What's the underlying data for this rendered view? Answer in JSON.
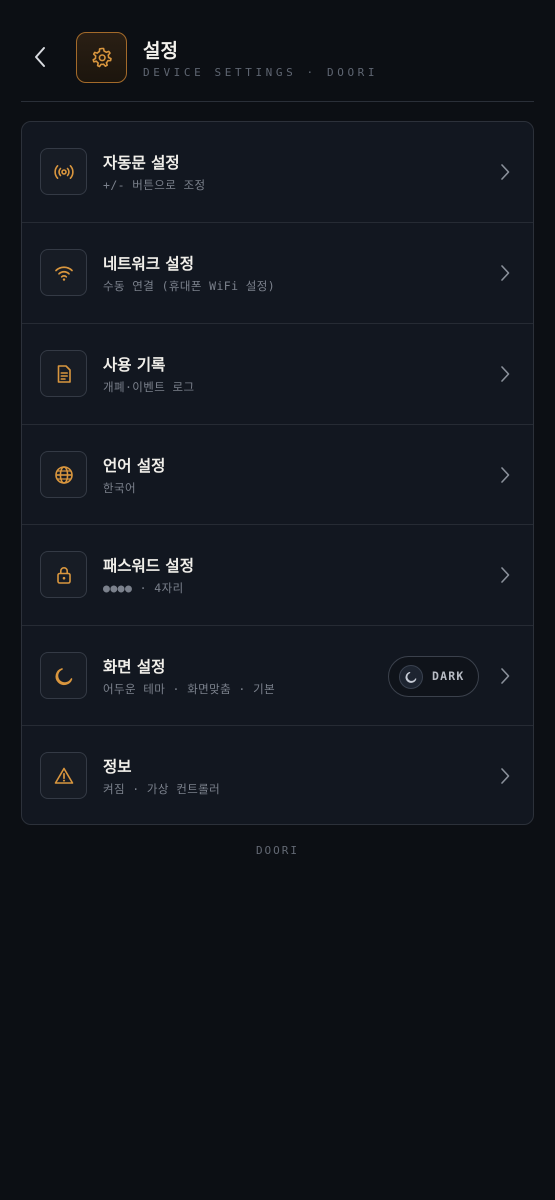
{
  "header": {
    "title": "설정",
    "subtitle": "DEVICE SETTINGS · DOORI",
    "back_icon": "chevron-left-icon",
    "app_icon": "gear-icon"
  },
  "colors": {
    "accent": "#d9963e",
    "background": "#0c0f14",
    "card": "#121720"
  },
  "settings": [
    {
      "title": "자동문 설정",
      "subtitle": "+/- 버튼으로 조정",
      "icon": "broadcast-icon"
    },
    {
      "title": "네트워크 설정",
      "subtitle": "수동 연결 (휴대폰 WiFi 설정)",
      "icon": "wifi-icon"
    },
    {
      "title": "사용 기록",
      "subtitle": "개폐·이벤트 로그",
      "icon": "document-icon"
    },
    {
      "title": "언어 설정",
      "subtitle": "한국어",
      "icon": "globe-icon"
    },
    {
      "title": "패스워드 설정",
      "subtitle": "●●●● · 4자리",
      "icon": "lock-icon"
    },
    {
      "title": "화면 설정",
      "subtitle": "어두운 테마 · 화면맞춤 · 기본",
      "icon": "moon-icon",
      "toggle_label": "DARK"
    },
    {
      "title": "정보",
      "subtitle": "켜짐 · 가상 컨트롤러",
      "icon": "warning-icon"
    }
  ],
  "footer": "DOORI"
}
